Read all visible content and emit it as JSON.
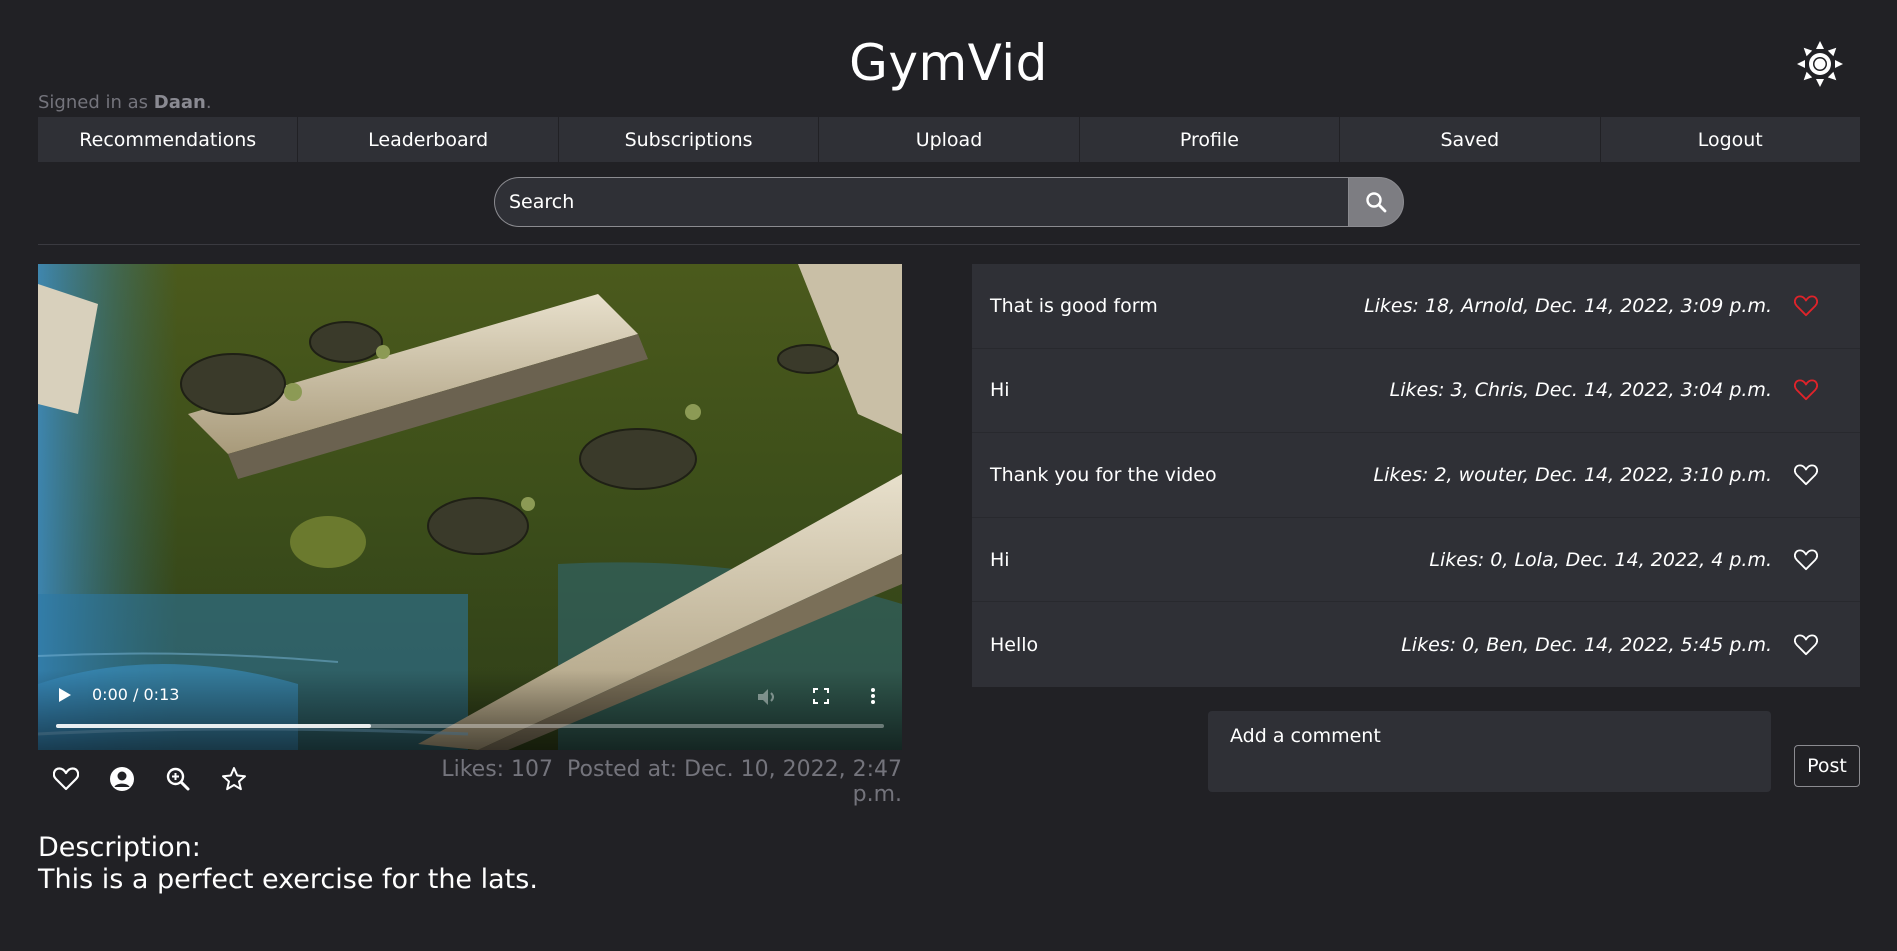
{
  "app": {
    "title": "GymVid",
    "theme_icon": "sun-icon"
  },
  "user": {
    "prefix": "Signed in as ",
    "name": "Daan",
    "suffix": "."
  },
  "nav": {
    "items": [
      "Recommendations",
      "Leaderboard",
      "Subscriptions",
      "Upload",
      "Profile",
      "Saved",
      "Logout"
    ]
  },
  "search": {
    "placeholder": "Search",
    "icon": "search-icon"
  },
  "video": {
    "time": "0:00 / 0:13",
    "buffered_fraction": 0.38,
    "likes_text": "Likes: 107",
    "posted_text": "Posted at: Dec. 10, 2022, 2:47 p.m.",
    "actions": [
      "heart-icon",
      "user-circle-icon",
      "zoom-in-icon",
      "star-icon"
    ]
  },
  "description": {
    "label": "Description:",
    "text": "This is a perfect exercise for the lats."
  },
  "comments": [
    {
      "text": "That is good form",
      "meta": "Likes: 18, Arnold, Dec. 14, 2022, 3:09 p.m.",
      "liked": true
    },
    {
      "text": "Hi",
      "meta": "Likes: 3, Chris, Dec. 14, 2022, 3:04 p.m.",
      "liked": true
    },
    {
      "text": "Thank you for the video",
      "meta": "Likes: 2, wouter, Dec. 14, 2022, 3:10 p.m.",
      "liked": false
    },
    {
      "text": "Hi",
      "meta": "Likes: 0, Lola, Dec. 14, 2022, 4 p.m.",
      "liked": false
    },
    {
      "text": "Hello",
      "meta": "Likes: 0, Ben, Dec. 14, 2022, 5:45 p.m.",
      "liked": false
    }
  ],
  "comment_form": {
    "placeholder": "Add a comment",
    "post_label": "Post"
  },
  "colors": {
    "background": "#212125",
    "panel": "#2f3036",
    "liked_heart": "#e0232a",
    "muted_text": "#74747c"
  }
}
